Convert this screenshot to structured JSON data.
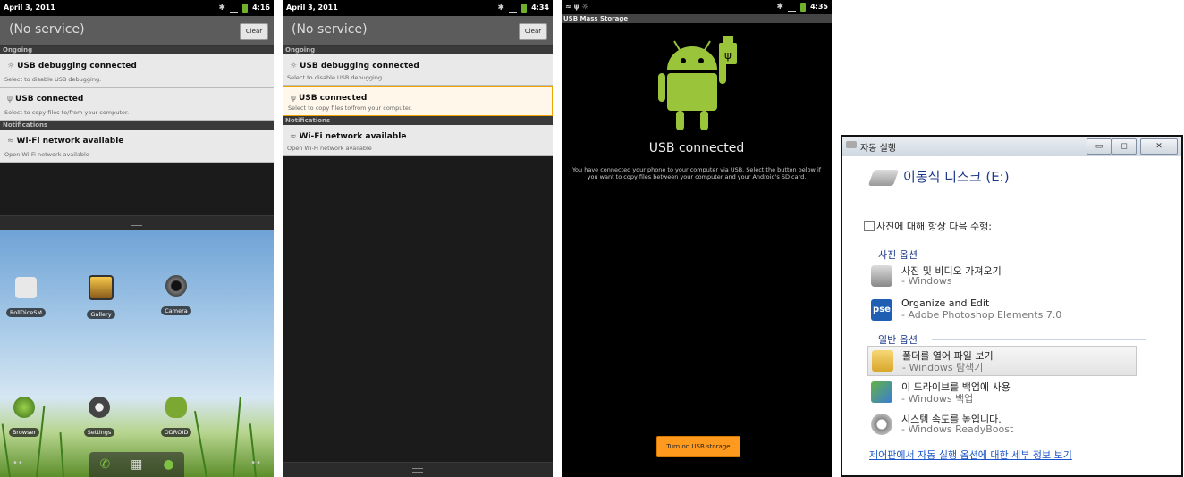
{
  "panel1": {
    "status": {
      "date": "April 3, 2011",
      "time": "4:16"
    },
    "header": {
      "title": "(No service)",
      "clear_label": "Clear"
    },
    "ongoing_label": "Ongoing",
    "notifications_label": "Notifications",
    "items": [
      {
        "title": "USB debugging connected",
        "subtitle": "Select to disable USB debugging.",
        "icon": "android-bug-icon"
      },
      {
        "title": "USB connected",
        "subtitle": "Select to copy files to/from your computer.",
        "icon": "usb-icon"
      },
      {
        "title": "Wi-Fi network available",
        "subtitle": "Open Wi-Fi network available",
        "icon": "wifi-icon"
      }
    ],
    "apps": [
      "RollDiceSM",
      "Gallery",
      "Camera",
      "Browser",
      "Settings",
      "ODROID"
    ]
  },
  "panel2": {
    "status": {
      "date": "April 3, 2011",
      "time": "4:34"
    },
    "header": {
      "title": "(No service)",
      "clear_label": "Clear"
    },
    "ongoing_label": "Ongoing",
    "notifications_label": "Notifications",
    "items": [
      {
        "title": "USB debugging connected",
        "subtitle": "Select to disable USB debugging."
      },
      {
        "title": "USB connected",
        "subtitle": "Select to copy files to/from your computer."
      },
      {
        "title": "Wi-Fi network available",
        "subtitle": "Open Wi-Fi network available"
      }
    ]
  },
  "panel3": {
    "status": {
      "time": "4:35"
    },
    "bar_title": "USB Mass Storage",
    "title": "USB connected",
    "description": "You have connected your phone to your computer via USB. Select the button below if you want to copy files between your computer and your Android's SD card.",
    "button_label": "Turn on USB storage"
  },
  "panel4": {
    "window_title": "자동 실행",
    "drive_title": "이동식 디스크 (E:)",
    "checkbox_label": "사진에 대해 항상 다음 수행:",
    "photo_section": "사진 옵션",
    "general_section": "일반 옵션",
    "options": [
      {
        "line1": "사진 및 비디오 가져오기",
        "line2": "- Windows",
        "icon": "camera-icon"
      },
      {
        "line1": "Organize and Edit",
        "line2": "- Adobe Photoshop Elements 7.0",
        "icon": "pse-icon",
        "icon_text": "pse"
      },
      {
        "line1": "폴더를 열어 파일 보기",
        "line2": "- Windows 탐색기",
        "icon": "folder-icon"
      },
      {
        "line1": "이 드라이브를 백업에 사용",
        "line2": "- Windows 백업",
        "icon": "backup-icon"
      },
      {
        "line1": "시스템 속도를 높입니다.",
        "line2": "- Windows ReadyBoost",
        "icon": "readyboost-icon"
      }
    ],
    "link_text": "제어판에서 자동 실행 옵션에 대한 세부 정보 보기"
  }
}
